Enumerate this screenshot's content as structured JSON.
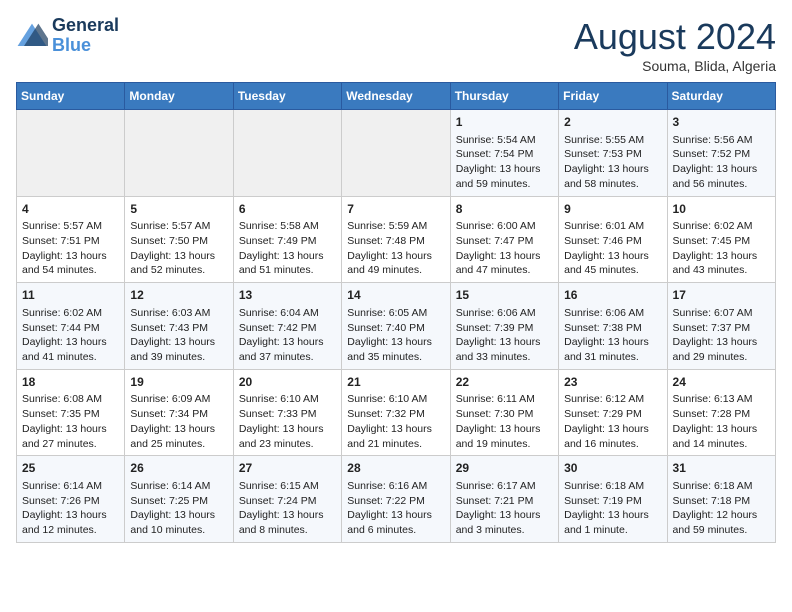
{
  "header": {
    "logo_line1": "General",
    "logo_line2": "Blue",
    "title": "August 2024",
    "subtitle": "Souma, Blida, Algeria"
  },
  "weekdays": [
    "Sunday",
    "Monday",
    "Tuesday",
    "Wednesday",
    "Thursday",
    "Friday",
    "Saturday"
  ],
  "weeks": [
    [
      {
        "day": "",
        "info": ""
      },
      {
        "day": "",
        "info": ""
      },
      {
        "day": "",
        "info": ""
      },
      {
        "day": "",
        "info": ""
      },
      {
        "day": "1",
        "info": "Sunrise: 5:54 AM\nSunset: 7:54 PM\nDaylight: 13 hours\nand 59 minutes."
      },
      {
        "day": "2",
        "info": "Sunrise: 5:55 AM\nSunset: 7:53 PM\nDaylight: 13 hours\nand 58 minutes."
      },
      {
        "day": "3",
        "info": "Sunrise: 5:56 AM\nSunset: 7:52 PM\nDaylight: 13 hours\nand 56 minutes."
      }
    ],
    [
      {
        "day": "4",
        "info": "Sunrise: 5:57 AM\nSunset: 7:51 PM\nDaylight: 13 hours\nand 54 minutes."
      },
      {
        "day": "5",
        "info": "Sunrise: 5:57 AM\nSunset: 7:50 PM\nDaylight: 13 hours\nand 52 minutes."
      },
      {
        "day": "6",
        "info": "Sunrise: 5:58 AM\nSunset: 7:49 PM\nDaylight: 13 hours\nand 51 minutes."
      },
      {
        "day": "7",
        "info": "Sunrise: 5:59 AM\nSunset: 7:48 PM\nDaylight: 13 hours\nand 49 minutes."
      },
      {
        "day": "8",
        "info": "Sunrise: 6:00 AM\nSunset: 7:47 PM\nDaylight: 13 hours\nand 47 minutes."
      },
      {
        "day": "9",
        "info": "Sunrise: 6:01 AM\nSunset: 7:46 PM\nDaylight: 13 hours\nand 45 minutes."
      },
      {
        "day": "10",
        "info": "Sunrise: 6:02 AM\nSunset: 7:45 PM\nDaylight: 13 hours\nand 43 minutes."
      }
    ],
    [
      {
        "day": "11",
        "info": "Sunrise: 6:02 AM\nSunset: 7:44 PM\nDaylight: 13 hours\nand 41 minutes."
      },
      {
        "day": "12",
        "info": "Sunrise: 6:03 AM\nSunset: 7:43 PM\nDaylight: 13 hours\nand 39 minutes."
      },
      {
        "day": "13",
        "info": "Sunrise: 6:04 AM\nSunset: 7:42 PM\nDaylight: 13 hours\nand 37 minutes."
      },
      {
        "day": "14",
        "info": "Sunrise: 6:05 AM\nSunset: 7:40 PM\nDaylight: 13 hours\nand 35 minutes."
      },
      {
        "day": "15",
        "info": "Sunrise: 6:06 AM\nSunset: 7:39 PM\nDaylight: 13 hours\nand 33 minutes."
      },
      {
        "day": "16",
        "info": "Sunrise: 6:06 AM\nSunset: 7:38 PM\nDaylight: 13 hours\nand 31 minutes."
      },
      {
        "day": "17",
        "info": "Sunrise: 6:07 AM\nSunset: 7:37 PM\nDaylight: 13 hours\nand 29 minutes."
      }
    ],
    [
      {
        "day": "18",
        "info": "Sunrise: 6:08 AM\nSunset: 7:35 PM\nDaylight: 13 hours\nand 27 minutes."
      },
      {
        "day": "19",
        "info": "Sunrise: 6:09 AM\nSunset: 7:34 PM\nDaylight: 13 hours\nand 25 minutes."
      },
      {
        "day": "20",
        "info": "Sunrise: 6:10 AM\nSunset: 7:33 PM\nDaylight: 13 hours\nand 23 minutes."
      },
      {
        "day": "21",
        "info": "Sunrise: 6:10 AM\nSunset: 7:32 PM\nDaylight: 13 hours\nand 21 minutes."
      },
      {
        "day": "22",
        "info": "Sunrise: 6:11 AM\nSunset: 7:30 PM\nDaylight: 13 hours\nand 19 minutes."
      },
      {
        "day": "23",
        "info": "Sunrise: 6:12 AM\nSunset: 7:29 PM\nDaylight: 13 hours\nand 16 minutes."
      },
      {
        "day": "24",
        "info": "Sunrise: 6:13 AM\nSunset: 7:28 PM\nDaylight: 13 hours\nand 14 minutes."
      }
    ],
    [
      {
        "day": "25",
        "info": "Sunrise: 6:14 AM\nSunset: 7:26 PM\nDaylight: 13 hours\nand 12 minutes."
      },
      {
        "day": "26",
        "info": "Sunrise: 6:14 AM\nSunset: 7:25 PM\nDaylight: 13 hours\nand 10 minutes."
      },
      {
        "day": "27",
        "info": "Sunrise: 6:15 AM\nSunset: 7:24 PM\nDaylight: 13 hours\nand 8 minutes."
      },
      {
        "day": "28",
        "info": "Sunrise: 6:16 AM\nSunset: 7:22 PM\nDaylight: 13 hours\nand 6 minutes."
      },
      {
        "day": "29",
        "info": "Sunrise: 6:17 AM\nSunset: 7:21 PM\nDaylight: 13 hours\nand 3 minutes."
      },
      {
        "day": "30",
        "info": "Sunrise: 6:18 AM\nSunset: 7:19 PM\nDaylight: 13 hours\nand 1 minute."
      },
      {
        "day": "31",
        "info": "Sunrise: 6:18 AM\nSunset: 7:18 PM\nDaylight: 12 hours\nand 59 minutes."
      }
    ]
  ]
}
